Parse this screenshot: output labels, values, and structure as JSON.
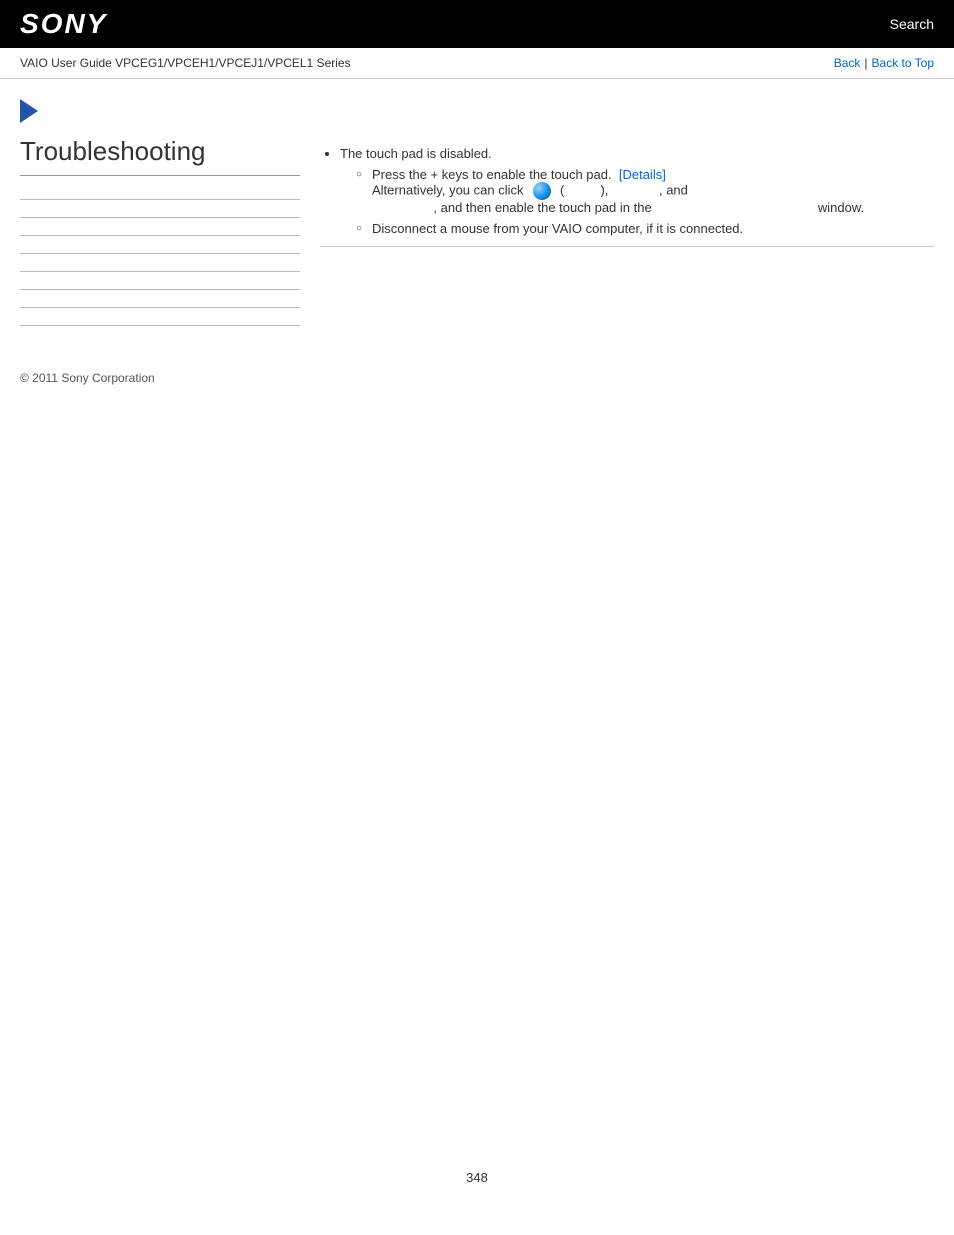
{
  "header": {
    "logo": "SONY",
    "search_label": "Search"
  },
  "breadcrumb": {
    "guide_title": "VAIO User Guide VPCEG1/VPCEH1/VPCEJ1/VPCEL1 Series",
    "back_label": "Back",
    "separator": "|",
    "back_to_top_label": "Back to Top"
  },
  "sidebar": {
    "section_title": "Troubleshooting",
    "placeholders": [
      "",
      "",
      "",
      "",
      "",
      "",
      "",
      ""
    ]
  },
  "content": {
    "bullet1": "The touch pad is disabled.",
    "sub1a_prefix": "Press the",
    "sub1a_keys": " + ",
    "sub1a_suffix": "keys to enable the touch pad.",
    "sub1a_details": "[Details]",
    "sub1b_alt_prefix": "Alternatively, you can click",
    "sub1b_alt_middle1": "(",
    "sub1b_alt_middle2": "),",
    "sub1b_alt_and": ", and",
    "sub1b_alt_suffix": ", and then enable the touch pad in the",
    "sub1b_alt_window": "window.",
    "bullet2_sub": "Disconnect a mouse from your VAIO computer, if it is connected."
  },
  "footer": {
    "copyright": "© 2011 Sony Corporation"
  },
  "page": {
    "number": "348"
  }
}
